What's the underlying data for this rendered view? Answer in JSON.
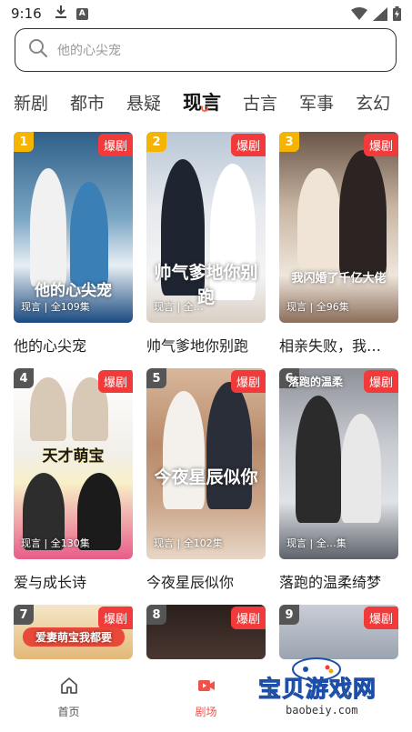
{
  "status_bar": {
    "time": "9:16",
    "download_icon": "download-icon",
    "a_icon_label": "A",
    "wifi_icon": "wifi-icon",
    "signal_icon": "signal-icon",
    "battery_icon": "battery-icon"
  },
  "search": {
    "placeholder": "他的心尖宠",
    "icon": "search-icon"
  },
  "tabs": [
    {
      "label": "新剧"
    },
    {
      "label": "都市"
    },
    {
      "label": "悬疑"
    },
    {
      "label": "现言",
      "active": true
    },
    {
      "label": "古言"
    },
    {
      "label": "军事"
    },
    {
      "label": "玄幻"
    }
  ],
  "colors": {
    "accent": "#f0524a",
    "badge": "#f23a3a",
    "rank_gold": "#f5b400",
    "rank_gray": "#555555"
  },
  "cards": [
    {
      "rank": "1",
      "badge": "爆剧",
      "title": "他的心尖宠",
      "poster_caption": "现言 | 全109集",
      "poster_title": "他的心尖宠"
    },
    {
      "rank": "2",
      "badge": "爆剧",
      "title": "帅气爹地你别跑",
      "poster_caption": "现言 | 全…",
      "poster_title": "帅气爹地你别跑"
    },
    {
      "rank": "3",
      "badge": "爆剧",
      "title": "相亲失败，我…",
      "poster_caption": "现言 | 全96集",
      "poster_title": "我闪婚了千亿大佬"
    },
    {
      "rank": "4",
      "badge": "爆剧",
      "title": "爱与成长诗",
      "poster_caption": "现言 | 全130集",
      "poster_title": "天才萌宝"
    },
    {
      "rank": "5",
      "badge": "爆剧",
      "title": "今夜星辰似你",
      "poster_caption": "现言 | 全102集",
      "poster_title": "今夜星辰似你"
    },
    {
      "rank": "6",
      "badge": "爆剧",
      "title": "落跑的温柔绮梦",
      "poster_caption": "现言 | 全…集",
      "poster_title": "落跑的温柔"
    },
    {
      "rank": "7",
      "badge": "爆剧",
      "title": "",
      "poster_caption": "",
      "poster_title": "爱妻萌宝我都要"
    },
    {
      "rank": "8",
      "badge": "爆剧",
      "title": "",
      "poster_caption": "",
      "poster_title": ""
    },
    {
      "rank": "9",
      "badge": "爆剧",
      "title": "",
      "poster_caption": "",
      "poster_title": ""
    }
  ],
  "bottom_nav": [
    {
      "label": "首页",
      "icon": "home-icon"
    },
    {
      "label": "剧场",
      "icon": "theater-icon",
      "active": true
    },
    {
      "label": "",
      "icon": "profile-icon"
    }
  ],
  "watermark": {
    "text": "宝贝游戏网",
    "url": "baobeiy.com"
  }
}
